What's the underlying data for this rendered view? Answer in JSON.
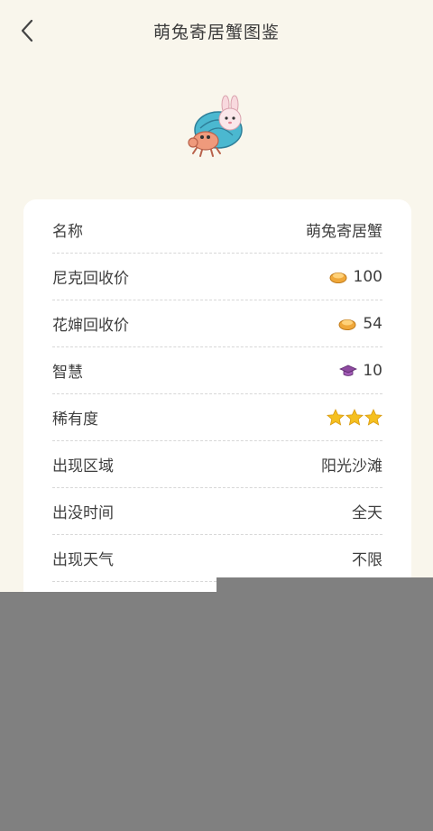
{
  "header": {
    "title": "萌兔寄居蟹图鉴"
  },
  "details": [
    {
      "label": "名称",
      "value": "萌兔寄居蟹",
      "icon": ""
    },
    {
      "label": "尼克回收价",
      "value": "100",
      "icon": "coin-icon"
    },
    {
      "label": "花婶回收价",
      "value": "54",
      "icon": "coin-icon"
    },
    {
      "label": "智慧",
      "value": "10",
      "icon": "graduation-cap-icon"
    },
    {
      "label": "稀有度",
      "value": "",
      "icon": "star-icon",
      "stars": 3
    },
    {
      "label": "出现区域",
      "value": "阳光沙滩",
      "icon": ""
    },
    {
      "label": "出没时间",
      "value": "全天",
      "icon": ""
    },
    {
      "label": "出现天气",
      "value": "不限",
      "icon": ""
    }
  ],
  "colors": {
    "background": "#f9f6ec",
    "card": "#ffffff",
    "coin": "#f0a83a",
    "cap": "#8e4aa0",
    "star": "#f5c020",
    "overlay": "#808080"
  }
}
